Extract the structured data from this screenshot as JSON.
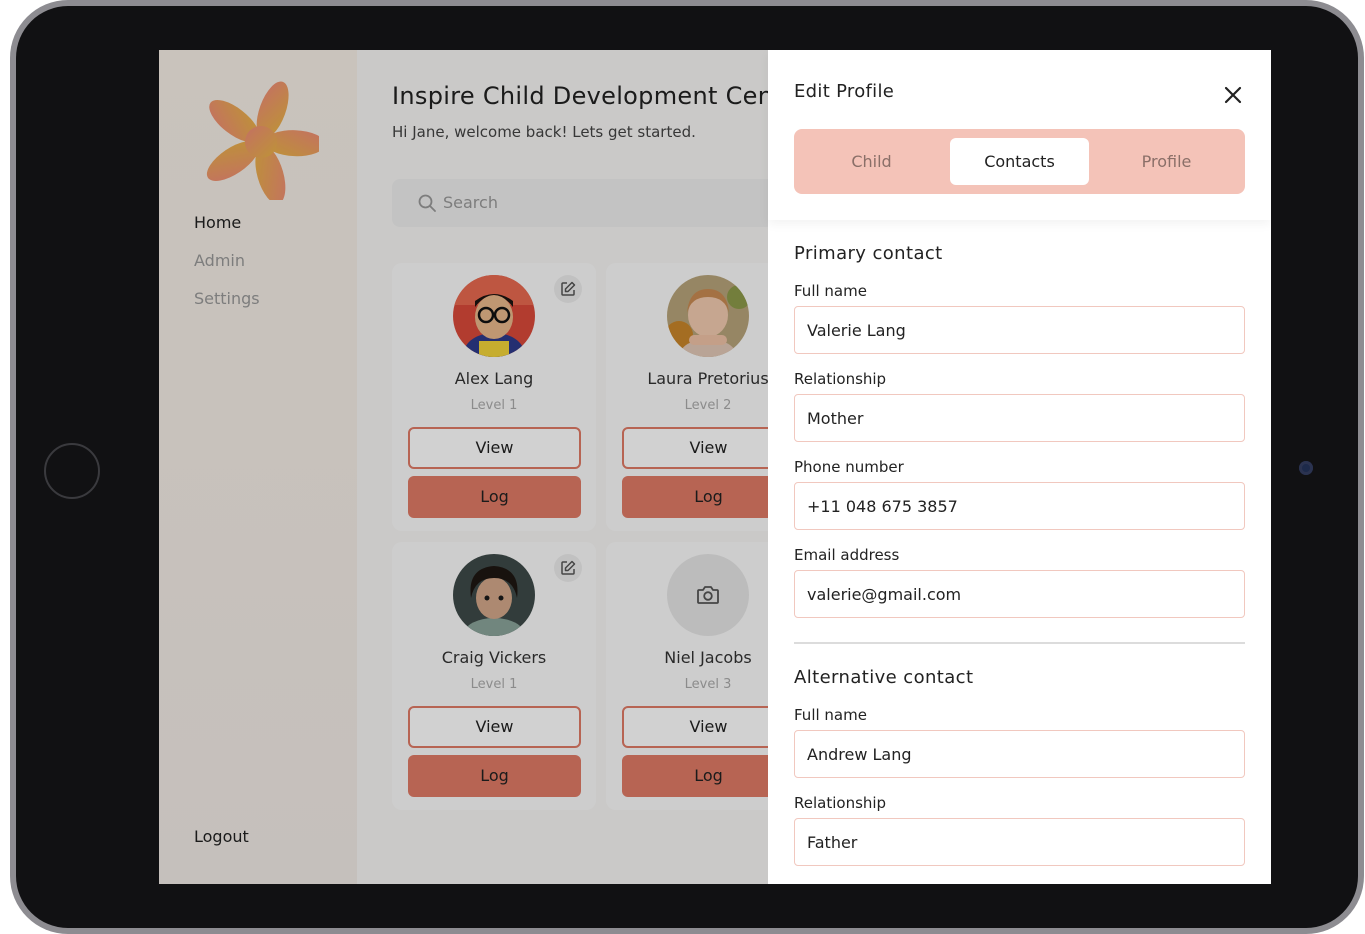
{
  "sidebar": {
    "nav": [
      "Home",
      "Admin",
      "Settings"
    ],
    "logout": "Logout"
  },
  "main": {
    "title": "Inspire Child Development Centre",
    "subtitle": "Hi Jane, welcome back! Lets get started.",
    "search_placeholder": "Search",
    "children": [
      {
        "name": "Alex Lang",
        "level": "Level 1",
        "view": "View",
        "log": "Log"
      },
      {
        "name": "Laura Pretorius",
        "level": "Level 2",
        "view": "View",
        "log": "Log"
      },
      {
        "name": "Craig Vickers",
        "level": "Level 1",
        "view": "View",
        "log": "Log"
      },
      {
        "name": "Niel Jacobs",
        "level": "Level 3",
        "view": "View",
        "log": "Log"
      }
    ]
  },
  "panel": {
    "title": "Edit Profile",
    "tabs": [
      "Child",
      "Contacts",
      "Profile"
    ],
    "active_tab": "Contacts",
    "primary": {
      "heading": "Primary contact",
      "full_name_label": "Full name",
      "full_name": "Valerie Lang",
      "relationship_label": "Relationship",
      "relationship": "Mother",
      "phone_label": "Phone number",
      "phone": "+11 048 675 3857",
      "email_label": "Email address",
      "email": "valerie@gmail.com"
    },
    "alternative": {
      "heading": "Alternative contact",
      "full_name_label": "Full name",
      "full_name": "Andrew Lang",
      "relationship_label": "Relationship",
      "relationship": "Father"
    }
  },
  "colors": {
    "accent": "#e07a66",
    "tab_bar": "#f4c3b8",
    "field_border": "#f1c8bf"
  }
}
